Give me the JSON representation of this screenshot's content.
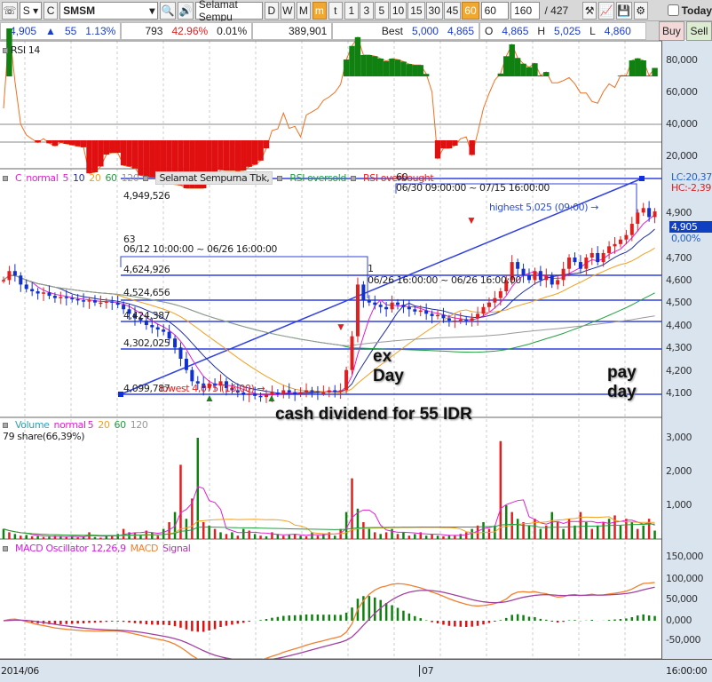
{
  "toolbar": {
    "market": "S",
    "type": "C",
    "symbol": "SMSM",
    "company": "Selamat Sempu",
    "periods": [
      "D",
      "W",
      "M",
      "m",
      "t"
    ],
    "active_period": "m",
    "minutes": [
      "1",
      "3",
      "5",
      "10",
      "15",
      "30",
      "45",
      "60"
    ],
    "active_minute": "60",
    "minute_select": "60",
    "count": "160",
    "total": "427",
    "today_label": "Today"
  },
  "quote": {
    "price": "4,905",
    "change": "55",
    "change_pct": "1.13%",
    "volume_ratio": "793",
    "pct2": "42.96%",
    "pct3": "0.01%",
    "volume": "389,901",
    "best_label": "Best",
    "best_ask": "5,000",
    "best_bid": "4,865",
    "open_label": "O",
    "open": "4,865",
    "high_label": "H",
    "high": "5,025",
    "low_label": "L",
    "low": "4,860",
    "buy": "Buy",
    "sell": "Sell"
  },
  "rsi_panel": {
    "title": "RSI 14",
    "ticks": [
      "80,000",
      "60,000",
      "40,000",
      "20,000"
    ]
  },
  "price_panel": {
    "legend": {
      "c": "C",
      "normal": "normal",
      "ma": [
        "5",
        "10",
        "20",
        "60",
        "120"
      ],
      "company": "Selamat Sempurna Tbk,",
      "oversold": "RSI oversold",
      "overbought": "RSI overbought"
    },
    "levels": [
      "4,949,526",
      "4,624,926",
      "4,524,656",
      "4,424,387",
      "4,302,025",
      "4,099,787"
    ],
    "range1": {
      "count": "63",
      "text": "06/12 10:00:00 ~ 06/26 16:00:00"
    },
    "range2": {
      "count": "1",
      "text": "06/26 16:00:00 ~ 06/26 16:00:00"
    },
    "range3": {
      "count": "60",
      "text": "06/30 09:00:00 ~ 07/15 16:00:00"
    },
    "highest": "highest 5,025 (09:00) →",
    "lowest": "lowest 4,075 (16:00) →",
    "lc": "LC:20,37",
    "hc": "HC:-2,39",
    "current": "4,905",
    "current_pct": "0,00%",
    "ticks": [
      "4,900",
      "4,700",
      "4,600",
      "4,500",
      "4,400",
      "4,300",
      "4,200",
      "4,100"
    ],
    "annotations": {
      "ex": "ex",
      "day": "Day",
      "pay": "pay",
      "payday": "day",
      "dividend": "cash dividend for 55 IDR"
    }
  },
  "volume_panel": {
    "title": "Volume",
    "normal": "normal",
    "ma": [
      "5",
      "20",
      "60",
      "120"
    ],
    "info": "79 share(66,39%)",
    "ticks": [
      "3,000",
      "2,000",
      "1,000"
    ]
  },
  "macd_panel": {
    "title": "MACD Oscillator 12,26,9",
    "macd": "MACD",
    "signal": "Signal",
    "ticks": [
      "150,000",
      "100,000",
      "50,000",
      "0,000",
      "-50,000"
    ]
  },
  "xaxis": {
    "start": "2014/06",
    "mid": "07",
    "time": "16:00:00"
  },
  "chart_data": {
    "type": "candlestick",
    "closes": [
      4600,
      4640,
      4620,
      4580,
      4560,
      4550,
      4540,
      4545,
      4530,
      4520,
      4525,
      4520,
      4515,
      4510,
      4505,
      4510,
      4500,
      4500,
      4505,
      4500,
      4490,
      4470,
      4450,
      4430,
      4420,
      4400,
      4390,
      4380,
      4370,
      4340,
      4300,
      4250,
      4200,
      4150,
      4140,
      4120,
      4140,
      4130,
      4150,
      4120,
      4110,
      4100,
      4090,
      4095,
      4085,
      4080,
      4090,
      4100,
      4095,
      4110,
      4100,
      4095,
      4100,
      4110,
      4105,
      4100,
      4100,
      4110,
      4105,
      4110,
      4200,
      4350,
      4580,
      4510,
      4500,
      4490,
      4480,
      4470,
      4500,
      4490,
      4480,
      4470,
      4460,
      4465,
      4450,
      4440,
      4445,
      4430,
      4420,
      4420,
      4425,
      4420,
      4430,
      4450,
      4480,
      4500,
      4520,
      4550,
      4600,
      4680,
      4650,
      4620,
      4600,
      4640,
      4600,
      4620,
      4580,
      4600,
      4650,
      4700,
      4680,
      4650,
      4700,
      4720,
      4680,
      4720,
      4750,
      4760,
      4780,
      4800,
      4850,
      4900,
      4920,
      4880,
      4905
    ],
    "volumes": [
      300,
      200,
      150,
      100,
      120,
      80,
      90,
      60,
      70,
      100,
      80,
      60,
      90,
      50,
      70,
      200,
      60,
      40,
      80,
      100,
      150,
      300,
      200,
      180,
      120,
      250,
      200,
      100,
      300,
      500,
      800,
      2200,
      600,
      1200,
      3000,
      500,
      400,
      300,
      200,
      150,
      200,
      100,
      300,
      250,
      150,
      100,
      80,
      200,
      150,
      100,
      120,
      150,
      100,
      80,
      200,
      100,
      150,
      200,
      100,
      300,
      800,
      1800,
      900,
      500,
      300,
      200,
      150,
      200,
      300,
      150,
      200,
      100,
      150,
      200,
      100,
      150,
      100,
      80,
      120,
      100,
      150,
      200,
      300,
      400,
      500,
      300,
      400,
      2900,
      1000,
      800,
      600,
      500,
      400,
      600,
      300,
      400,
      800,
      500,
      300,
      600,
      400,
      800,
      500,
      300,
      400,
      500,
      600,
      700,
      400,
      600,
      500,
      300,
      400,
      600,
      250
    ]
  }
}
